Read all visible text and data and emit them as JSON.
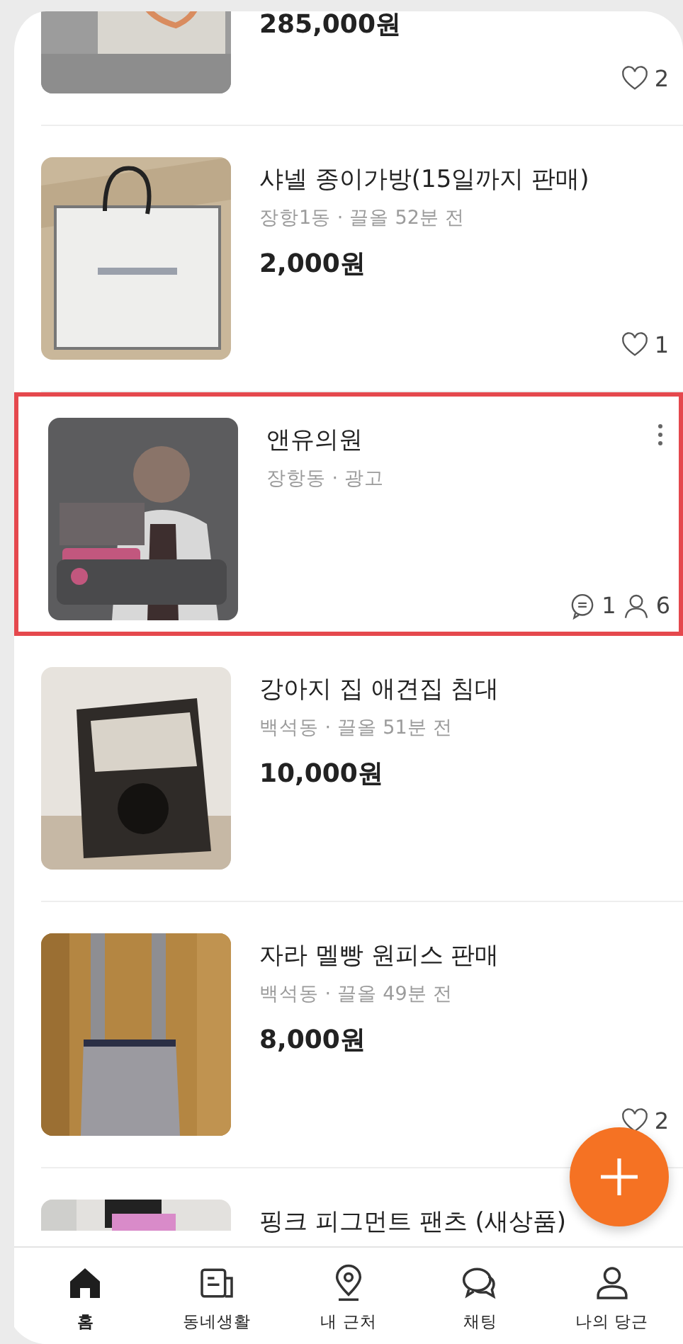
{
  "items": [
    {
      "kind": "partial",
      "price": "285,000원",
      "likes": "2"
    },
    {
      "kind": "listing",
      "title": "샤넬 종이가방(15일까지 판매)",
      "meta": "장항1동 · 끌올 52분 전",
      "price": "2,000원",
      "likes": "1"
    },
    {
      "kind": "ad",
      "title": "앤유의원",
      "meta": "장항동 · 광고",
      "comments": "1",
      "people": "6",
      "highlighted": true
    },
    {
      "kind": "listing",
      "title": "강아지 집 애견집 침대",
      "meta": "백석동 · 끌올 51분 전",
      "price": "10,000원"
    },
    {
      "kind": "listing",
      "title": "자라 멜빵 원피스 판매",
      "meta": "백석동 · 끌올 49분 전",
      "price": "8,000원",
      "likes": "2"
    },
    {
      "kind": "cutoff",
      "title": "핑크 피그먼트 팬츠 (새상품)"
    }
  ],
  "nav": [
    {
      "label": "홈",
      "selected": true
    },
    {
      "label": "동네생활",
      "selected": false
    },
    {
      "label": "내 근처",
      "selected": false
    },
    {
      "label": "채팅",
      "selected": false
    },
    {
      "label": "나의 당근",
      "selected": false
    }
  ]
}
